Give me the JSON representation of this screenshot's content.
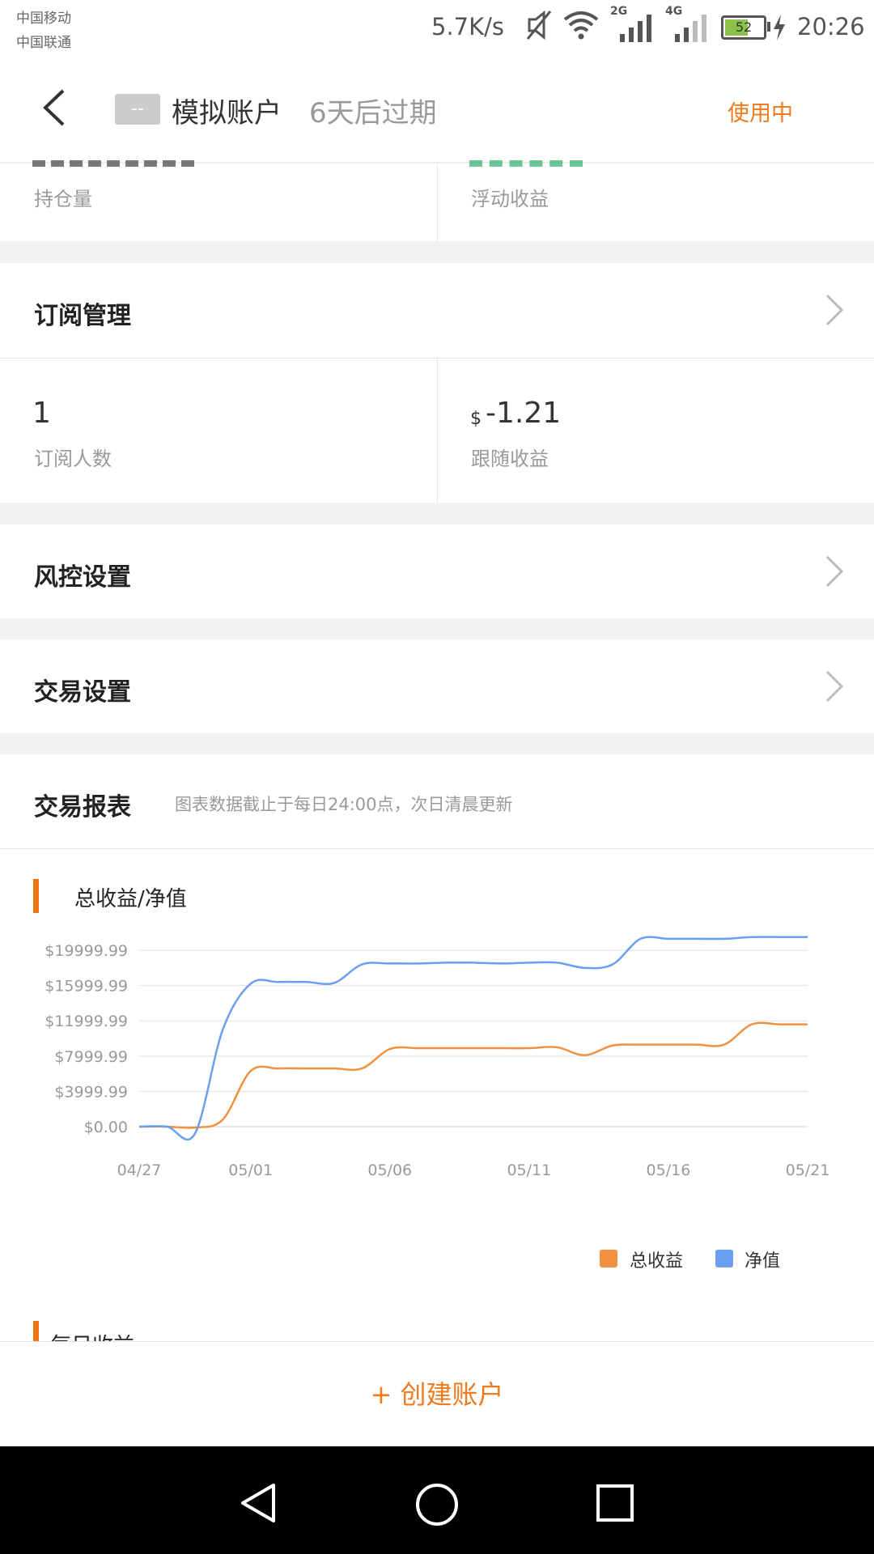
{
  "status_bar": {
    "carrier_1": "中国移动",
    "carrier_2": "中国联通",
    "net_speed": "5.7K/s",
    "net_2g": "2G",
    "net_4g": "4G",
    "battery": "52",
    "time": "20:26"
  },
  "header": {
    "badge": "--",
    "account_name": "模拟账户",
    "expire": "6天后过期",
    "status": "使用中"
  },
  "holdings": {
    "left_label": "持仓量",
    "right_label": "浮动收益"
  },
  "subscription": {
    "title": "订阅管理",
    "subscribers_value": "1",
    "subscribers_label": "订阅人数",
    "follow_currency": "$",
    "follow_value": "-1.21",
    "follow_label": "跟随收益"
  },
  "risk": {
    "title": "风控设置"
  },
  "trade_settings": {
    "title": "交易设置"
  },
  "report": {
    "title": "交易报表",
    "subtitle": "图表数据截止于每日24:00点，次日清晨更新"
  },
  "chart_data": {
    "type": "line",
    "title": "总收益/净值",
    "x": [
      "04/27",
      "04/28",
      "04/29",
      "04/30",
      "05/01",
      "05/02",
      "05/03",
      "05/04",
      "05/05",
      "05/06",
      "05/07",
      "05/08",
      "05/09",
      "05/10",
      "05/11",
      "05/12",
      "05/13",
      "05/14",
      "05/15",
      "05/16",
      "05/17",
      "05/18",
      "05/19",
      "05/20",
      "05/21"
    ],
    "xticks": [
      "04/27",
      "05/01",
      "05/06",
      "05/11",
      "05/16",
      "05/21"
    ],
    "yticks": [
      "$0.00",
      "$3999.99",
      "$7999.99",
      "$11999.99",
      "$15999.99",
      "$19999.99"
    ],
    "ylim": [
      0,
      21200
    ],
    "grid": true,
    "legend": "bottom-right",
    "series": [
      {
        "name": "总收益",
        "color": "#f0913f",
        "values": [
          0,
          0,
          -100,
          800,
          6300,
          6600,
          6600,
          6600,
          6600,
          8800,
          8900,
          8900,
          8900,
          8900,
          8900,
          9000,
          8100,
          9200,
          9300,
          9300,
          9300,
          9300,
          11600,
          11600,
          11600
        ]
      },
      {
        "name": "净值",
        "color": "#6a9ff0",
        "values": [
          0,
          0,
          -800,
          11000,
          16200,
          16400,
          16400,
          16300,
          18400,
          18500,
          18500,
          18600,
          18600,
          18500,
          18600,
          18600,
          18000,
          18400,
          21300,
          21300,
          21300,
          21300,
          21500,
          21500,
          21500
        ]
      }
    ]
  },
  "daily_section": {
    "title": "每日收益"
  },
  "create_button": "+ 创建账户"
}
